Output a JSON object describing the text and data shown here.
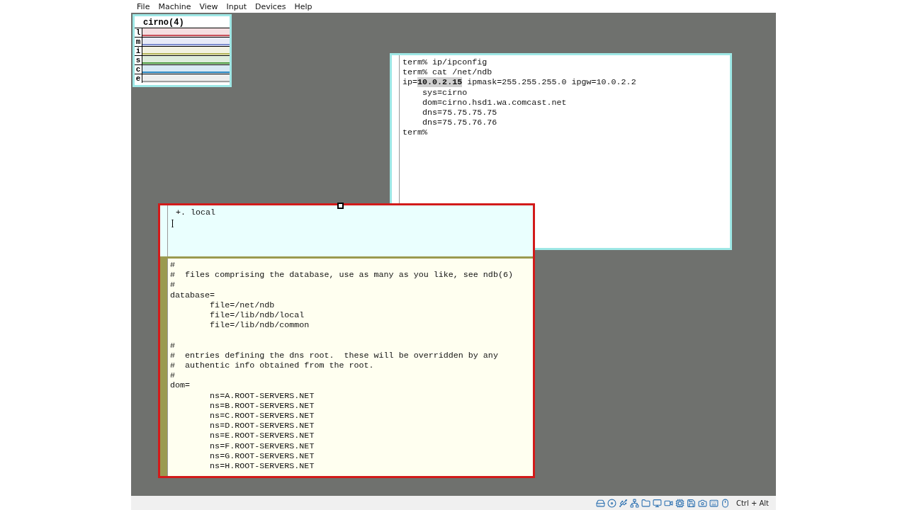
{
  "menu": [
    "File",
    "Machine",
    "View",
    "Input",
    "Devices",
    "Help"
  ],
  "stats": {
    "title": "cirno(4)",
    "meters": [
      {
        "label": "l",
        "color": "#c8505a"
      },
      {
        "label": "m",
        "color": "#7f8fd0"
      },
      {
        "label": "i",
        "color": "#b5b55a"
      },
      {
        "label": "s",
        "color": "#4c9a40"
      },
      {
        "label": "c",
        "color": "#2a86c0"
      },
      {
        "label": "e",
        "color": "#a0a0a0"
      }
    ]
  },
  "terminal": {
    "lines": [
      [
        {
          "text": "term% ip/ipconfig",
          "selected": false
        }
      ],
      [
        {
          "text": "term% cat /net/ndb",
          "selected": false
        }
      ],
      [
        {
          "text": "ip=",
          "selected": false
        },
        {
          "text": "10.0.2.15",
          "selected": true
        },
        {
          "text": " ipmask=255.255.255.0 ipgw=10.0.2.2",
          "selected": false
        }
      ],
      [
        {
          "text": "\tsys=cirno",
          "selected": false
        }
      ],
      [
        {
          "text": "\tdom=cirno.hsd1.wa.comcast.net",
          "selected": false
        }
      ],
      [
        {
          "text": "\tdns=75.75.75.75",
          "selected": false
        }
      ],
      [
        {
          "text": "\tdns=75.75.76.76",
          "selected": false
        }
      ],
      [
        {
          "text": "term%",
          "selected": false
        }
      ]
    ]
  },
  "editor": {
    "selected": true,
    "tag": "+. local",
    "body": [
      [
        "#",
        "#  files comprising the database, use as many as you like, see ndb(6)",
        "#",
        "database=",
        "\tfile=/net/ndb",
        "\tfile=/lib/ndb/local",
        "\tfile=/lib/ndb/common"
      ],
      [
        "#",
        "#  entries defining the dns root.  these will be overridden by any",
        "#  authentic info obtained from the root.",
        "#",
        "dom=",
        "\tns=A.ROOT-SERVERS.NET",
        "\tns=B.ROOT-SERVERS.NET",
        "\tns=C.ROOT-SERVERS.NET",
        "\tns=D.ROOT-SERVERS.NET",
        "\tns=E.ROOT-SERVERS.NET",
        "\tns=F.ROOT-SERVERS.NET",
        "\tns=G.ROOT-SERVERS.NET",
        "\tns=H.ROOT-SERVERS.NET"
      ]
    ]
  },
  "status_bar": {
    "host_key": "Ctrl + Alt"
  }
}
